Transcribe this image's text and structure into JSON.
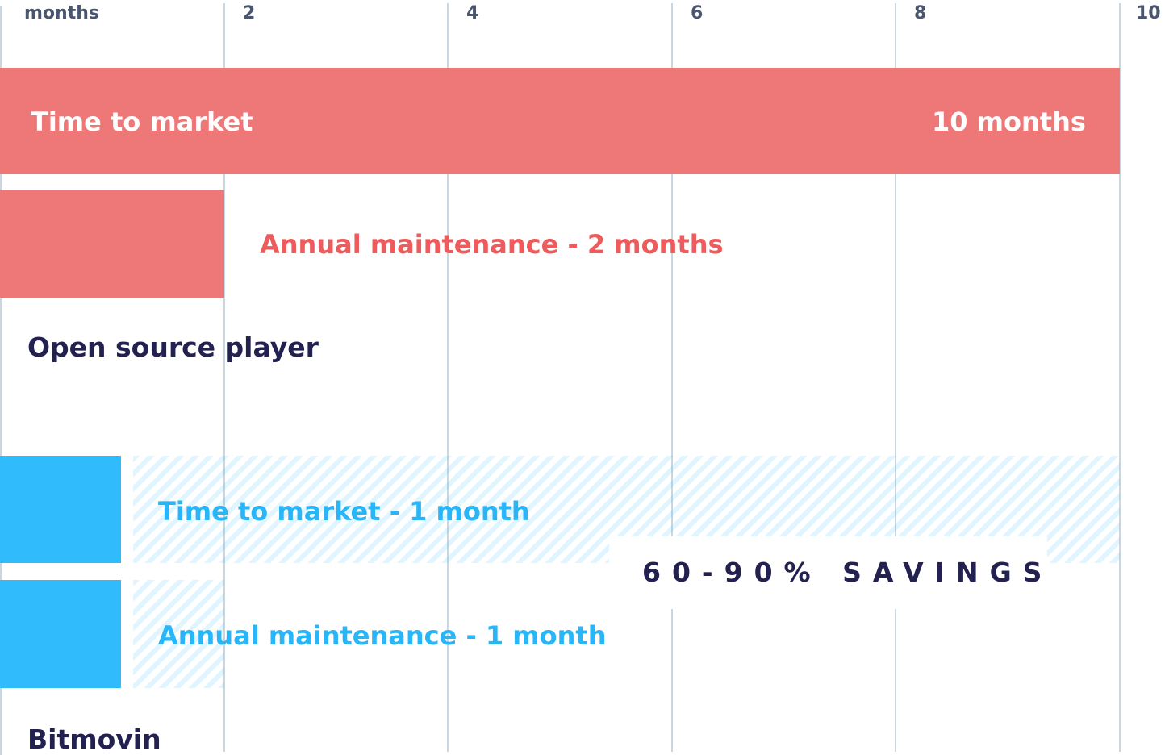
{
  "chart_data": {
    "type": "bar",
    "orientation": "horizontal",
    "title": "",
    "xlabel": "months",
    "ylabel": "",
    "xlim": [
      0,
      10
    ],
    "x_ticks": [
      2,
      4,
      6,
      8,
      10
    ],
    "x_tick_labels": [
      "2",
      "4",
      "6",
      "8",
      "10"
    ],
    "x_axis_label": "months",
    "grid": true,
    "groups": [
      {
        "name": "Open source player",
        "bars": [
          {
            "name": "Time to market",
            "value": 10,
            "label_left": "Time to market",
            "label_right": "10 months",
            "style": "solid",
            "color": "#ee7777"
          },
          {
            "name": "Annual maintenance",
            "value": 2,
            "label": "Annual maintenance - 2 months",
            "style": "solid",
            "color": "#ee7777"
          }
        ]
      },
      {
        "name": "Bitmovin",
        "bars": [
          {
            "name": "Time to market",
            "value": 1,
            "label": "Time to market - 1 month",
            "style": "solid",
            "color": "#30bbfd",
            "saved_range": [
              1,
              10
            ]
          },
          {
            "name": "Annual maintenance",
            "value": 1,
            "label": "Annual maintenance - 1 month",
            "style": "solid",
            "color": "#30bbfd",
            "saved_range": [
              1,
              2
            ]
          }
        ]
      }
    ],
    "annotation": "60-90% SAVINGS",
    "legend": "none"
  },
  "colors": {
    "open_source": "#ee7777",
    "open_source_text": "#ee5b5d",
    "bitmovin": "#30bbfd",
    "bitmovin_text": "#29b6f8",
    "group_label": "#23214f",
    "tick_label": "#4a5570",
    "grid": "#c8d7e1"
  }
}
